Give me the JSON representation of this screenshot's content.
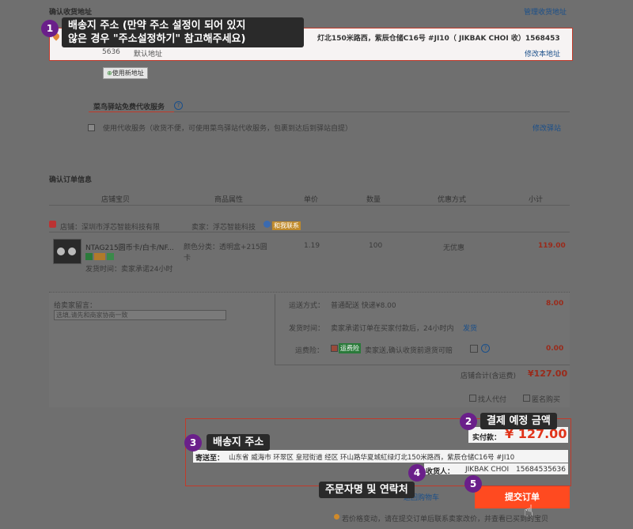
{
  "address": {
    "section_title": "确认收货地址",
    "manage_link": "管理收货地址",
    "address_text": "灯北150米路西，紫辰仓储C16号 #JI10（ JIKBAK CHOI 收）1568453",
    "address_phone_tail": "5636",
    "default_label": "默认地址",
    "modify_link": "修改本地址",
    "use_new_button": "使用新地址"
  },
  "cainiao": {
    "title": "菜鸟驿站免费代收服务",
    "checkbox_label": "使用代收服务（收货不便，可使用菜鸟驿站代收服务，包裹到达后到驿站自提）",
    "modify_link": "修改驿站"
  },
  "order": {
    "section_title": "确认订单信息",
    "columns": [
      "店铺宝贝",
      "商品属性",
      "单价",
      "数量",
      "优惠方式",
      "小计"
    ],
    "shop_label": "店铺：深圳市浮芯智能科技有限",
    "seller_label": "卖家：浮芯智能科技",
    "contact_badge": "和我联系",
    "item": {
      "name": "NTAG215圆币卡/白卡/NF...",
      "ship_time": "发货时间：卖家承诺24小时",
      "attribute": "颜色分类：透明盒+215圆卡",
      "price": "1.19",
      "qty": "100",
      "discount": "无优惠",
      "subtotal": "119.00"
    }
  },
  "extra": {
    "message_label": "给卖家留言：",
    "message_placeholder": "选填,请先和商家协商一致",
    "shipping_label": "运送方式：",
    "shipping_value": "普通配送 快递¥8.00",
    "shipping_fee": "8.00",
    "ship_time_label": "发货时间：",
    "ship_time_value": "卖家承诺订单在买家付款后，24小时内",
    "ship_time_link": "发货",
    "insurance_label": "运费险：",
    "insurance_badge": "运费险",
    "insurance_text": "卖家送,确认收货前退货可赔",
    "insurance_fee": "0.00",
    "store_total_label": "店铺合计(含运费)",
    "store_total_value": "¥127.00",
    "proxy_pay": "找人代付",
    "anonymous": "匿名购买"
  },
  "summary": {
    "paid_label": "实付款：",
    "paid_value": "¥ 127.00",
    "shipto_label": "寄送至：",
    "shipto_value": "山东省 威海市 环翠区 皇冠街道 经区 环山路华夏城紅绿灯北150米路西，紫辰仓储C16号 #JI10",
    "recipient_label": "收货人：",
    "recipient_name": "JIKBAK CHOI",
    "recipient_phone": "15684535636",
    "back_link": "返回购物车",
    "submit_button": "提交订单",
    "footer_note": "若价格变动，请在提交订单后联系卖家改价，并查看已买到的宝贝"
  },
  "callouts": {
    "c1_num": "1",
    "c1_text_line1": "배송지 주소 (만약 주소 설정이 되어 있지",
    "c1_text_line2": "않은 경우 \"주소설정하기\" 참고해주세요)",
    "c2_num": "2",
    "c2_text": "결제 예정 금액",
    "c3_num": "3",
    "c3_text": "배송지 주소",
    "c4_num": "4",
    "c4_text": "주문자명 및 연락처",
    "c5_num": "5"
  },
  "colors": {
    "accent_red": "#c23a2a",
    "overlay": "#6f6f6f",
    "callout_badge": "#6a1f8a"
  }
}
